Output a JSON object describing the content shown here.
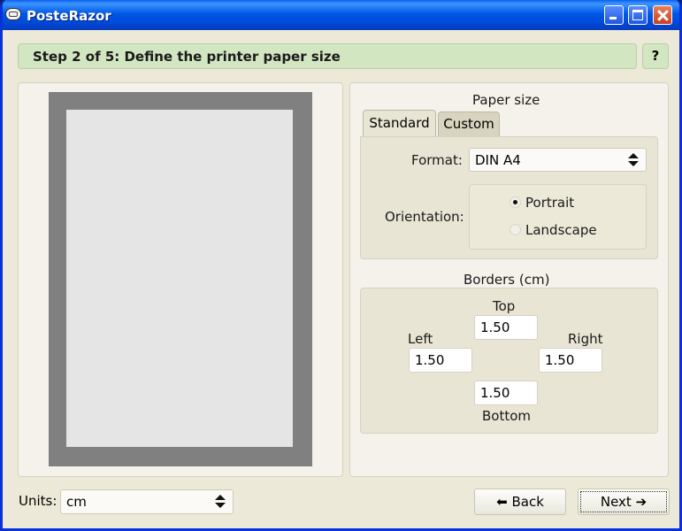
{
  "window": {
    "title": "PosteRazor"
  },
  "step": {
    "text": "Step 2 of 5: Define the printer paper size",
    "help_label": "?"
  },
  "paper_size": {
    "title": "Paper size",
    "tabs": [
      {
        "label": "Standard",
        "active": true
      },
      {
        "label": "Custom",
        "active": false
      }
    ],
    "format_label": "Format:",
    "format_value": "DIN A4",
    "orientation_label": "Orientation:",
    "orientation_options": [
      {
        "label": "Portrait",
        "checked": true
      },
      {
        "label": "Landscape",
        "checked": false
      }
    ]
  },
  "borders": {
    "title": "Borders (cm)",
    "top_label": "Top",
    "top_value": "1.50",
    "left_label": "Left",
    "left_value": "1.50",
    "right_label": "Right",
    "right_value": "1.50",
    "bottom_label": "Bottom",
    "bottom_value": "1.50"
  },
  "footer": {
    "units_label": "Units:",
    "units_value": "cm",
    "back_label": "Back",
    "next_label": "Next",
    "back_icon": "⬅",
    "next_icon": "➔"
  }
}
